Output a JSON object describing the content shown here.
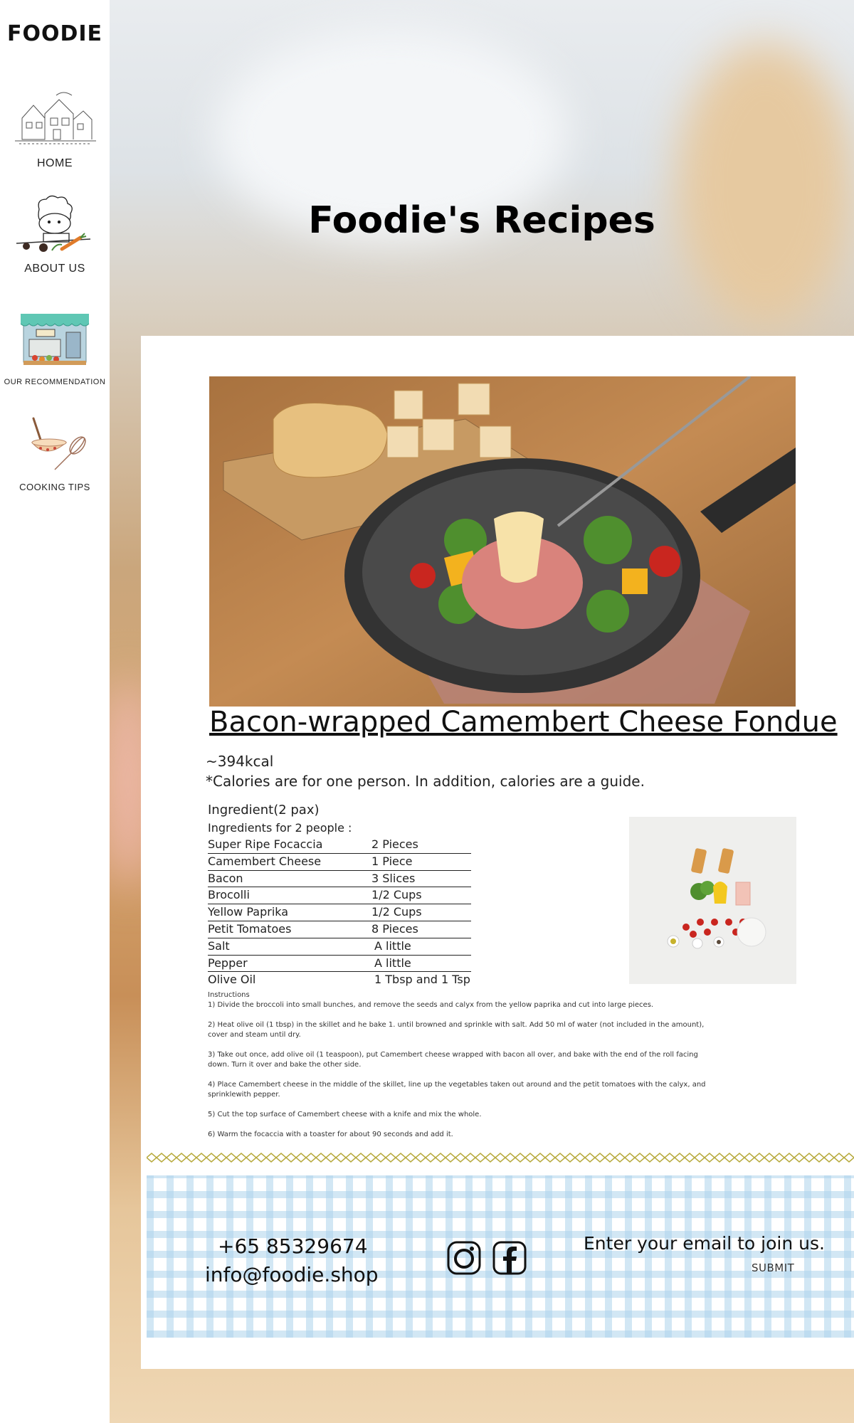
{
  "brand": {
    "logo": "FOODIE"
  },
  "sidebar": {
    "items": [
      {
        "label": "HOME"
      },
      {
        "label": "ABOUT US"
      },
      {
        "label": "OUR RECOMMENDATION"
      },
      {
        "label": "COOKING TIPS"
      }
    ]
  },
  "hero": {
    "title": "Foodie's Recipes"
  },
  "recipe": {
    "title": "Bacon-wrapped Camembert Cheese Fondue",
    "calories": "~394kcal",
    "calorie_note": "*Calories are for one person. In addition, calories are a guide.",
    "ingredients_heading": "Ingredient(2 pax)",
    "ingredients_sub": "Ingredients for 2 people :",
    "ingredients": [
      {
        "name": "Super Ripe Focaccia",
        "qty": "2 Pieces"
      },
      {
        "name": "Camembert Cheese",
        "qty": "1 Piece"
      },
      {
        "name": "Bacon",
        "qty": "3 Slices"
      },
      {
        "name": "Brocolli",
        "qty": "1/2 Cups"
      },
      {
        "name": "Yellow Paprika",
        "qty": "1/2 Cups"
      },
      {
        "name": "Petit Tomatoes",
        "qty": "8 Pieces"
      },
      {
        "name": "Salt",
        "qty": "A little"
      },
      {
        "name": "Pepper",
        "qty": "A little"
      },
      {
        "name": "Olive Oil",
        "qty": "1 Tbsp and 1 Tsp"
      }
    ],
    "instructions_heading": "Instructions",
    "steps": [
      "1) Divide the broccoli into small bunches, and remove the seeds and calyx from the yellow paprika and cut into large pieces.",
      "2) Heat olive oil (1 tbsp) in the skillet and he bake 1. until browned and sprinkle with salt. Add 50 ml of water (not included in the amount), cover and steam until dry.",
      "3) Take out once, add olive oil (1 teaspoon), put Camembert cheese wrapped with bacon all over, and bake with the end of the roll facing down. Turn it over and bake the other side.",
      "4) Place Camembert cheese in the middle of the skillet, line up the vegetables taken out around and the petit tomatoes with the calyx, and sprinklewith pepper.",
      "5) Cut the top surface of Camembert cheese with a knife and mix the whole.",
      "6) Warm the focaccia with a toaster for about 90 seconds and add it."
    ]
  },
  "footer": {
    "phone": "+65 85329674",
    "email": "info@foodie.shop",
    "join_text": "Enter your email to join us.",
    "email_placeholder": "",
    "submit_label": "SUBMIT",
    "social": [
      "instagram-icon",
      "facebook-icon"
    ]
  },
  "colors": {
    "zigzag": "#b7aa3d",
    "gingham": "#add3ec",
    "sidebar_bg": "#ffffff"
  }
}
